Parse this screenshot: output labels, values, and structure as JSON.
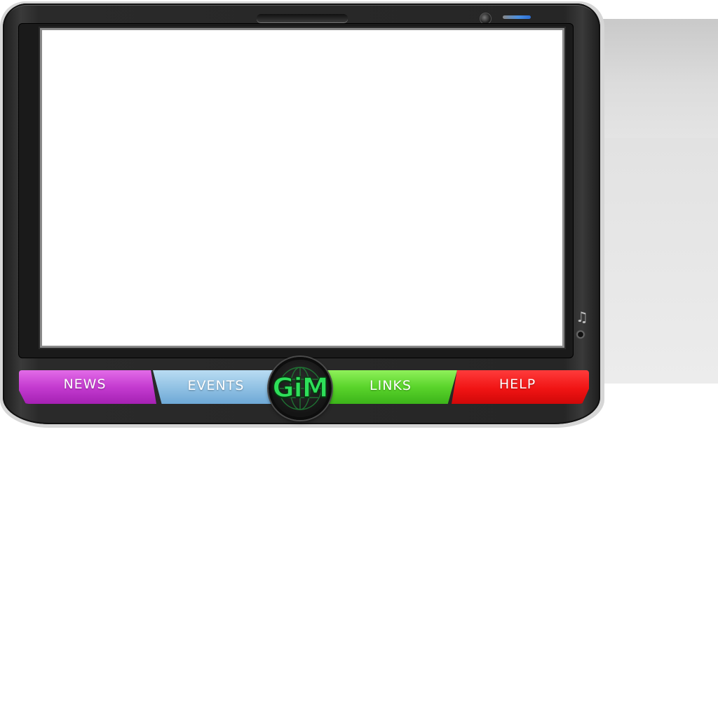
{
  "menu": {
    "news_label": "NEWS",
    "events_label": "EVENTS",
    "links_label": "LINKS",
    "help_label": "HELP"
  },
  "logo": {
    "text": "GiM"
  },
  "icons": {
    "music": "music-note-icon",
    "camera": "camera-icon",
    "speaker": "speaker-grille",
    "audio_jack": "audio-jack-icon",
    "status_led": "status-led"
  },
  "colors": {
    "news": "#c43bd0",
    "events": "#8fc0e3",
    "links": "#5ad42b",
    "help": "#f01414",
    "logo_green": "#2ee05a",
    "led_blue": "#4a90e2",
    "bezel": "#262626"
  }
}
